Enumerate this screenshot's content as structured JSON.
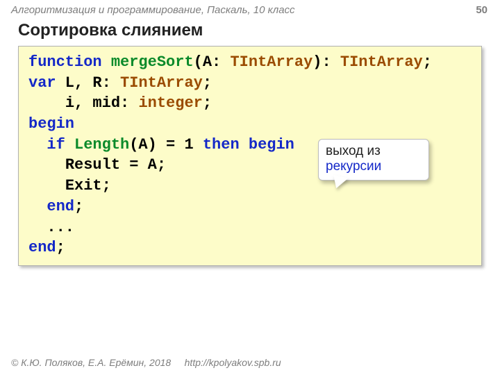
{
  "header": {
    "course_line": "Алгоритмизация и программирование, Паскаль, 10 класс",
    "page_num": "50"
  },
  "title": "Сортировка слиянием",
  "code": {
    "l1": {
      "kw1": "function",
      "sp": " ",
      "fn": "mergeSort",
      "p1": "(A: ",
      "typ1": "TIntArray",
      "p2": "): ",
      "typ2": "TIntArray",
      "semi": ";"
    },
    "l2": {
      "kw": "var",
      "rest": " L, R: ",
      "typ": "TIntArray",
      "semi": ";"
    },
    "l3": {
      "pad": "    ",
      "rest": "i, mid: ",
      "typ": "integer",
      "semi": ";"
    },
    "l4": {
      "kw": "begin"
    },
    "l5": {
      "pad": "  ",
      "kw1": "if",
      "mid1": " ",
      "fn": "Length",
      "mid2": "(A) = 1 ",
      "kw2": "then",
      "sp": " ",
      "kw3": "begin"
    },
    "l6": {
      "pad": "    ",
      "txt": "Result = A;"
    },
    "l7": {
      "pad": "    ",
      "txt": "Exit;"
    },
    "l8": {
      "pad": "  ",
      "kw": "end",
      "semi": ";"
    },
    "l9": {
      "pad": "  ",
      "txt": "..."
    },
    "l10": {
      "kw": "end",
      "semi": ";"
    }
  },
  "callout": {
    "line1": "выход из",
    "line2": "рекурсии"
  },
  "footer": {
    "copyright": "© К.Ю. Поляков, Е.А. Ерёмин, 2018",
    "url": "http://kpolyakov.spb.ru"
  }
}
